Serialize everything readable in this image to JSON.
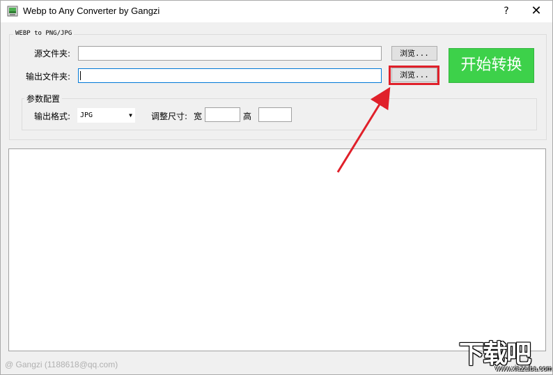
{
  "window": {
    "title": "Webp to Any Converter by Gangzi",
    "help_glyph": "?",
    "close_glyph": "✕"
  },
  "group": {
    "legend": "WEBP to PNG/JPG",
    "source_label": "源文件夹:",
    "source_value": "",
    "output_label": "输出文件夹:",
    "output_value": "",
    "browse_label": "浏览...",
    "start_label": "开始转换"
  },
  "params": {
    "legend": "参数配置",
    "format_label": "输出格式:",
    "format_value": "JPG",
    "resize_label": "调整尺寸:",
    "width_label": "宽",
    "width_value": "",
    "height_label": "高",
    "height_value": ""
  },
  "status": {
    "text": "@ Gangzi (1188618@qq.com)"
  },
  "watermark": {
    "main": "下载吧",
    "sub": "www.xiazaiba.com"
  },
  "colors": {
    "start_button": "#3dd14a",
    "highlight": "#e0202a",
    "focus_border": "#0078d7"
  }
}
